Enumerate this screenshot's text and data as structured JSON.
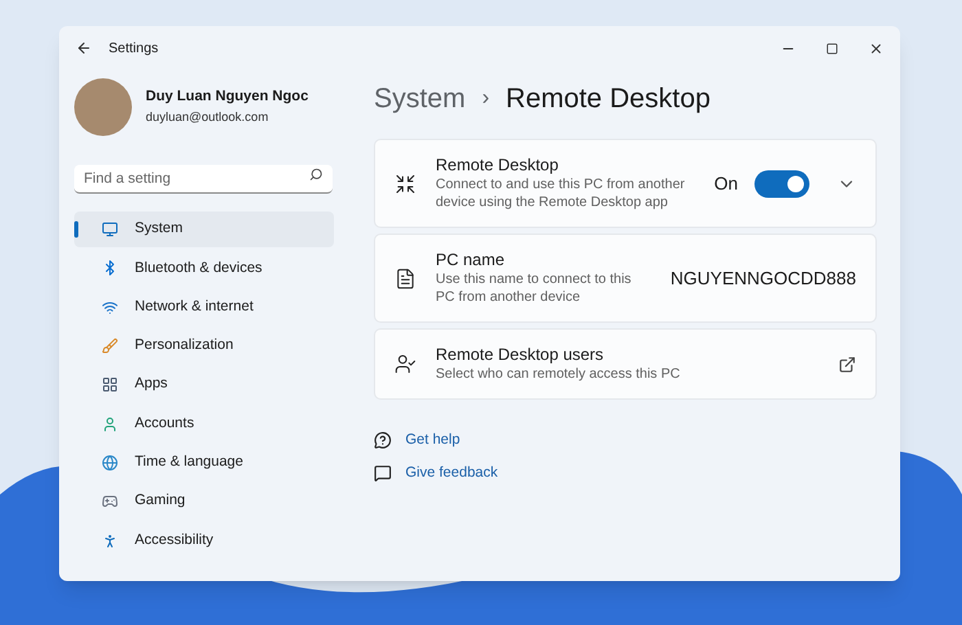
{
  "window": {
    "title": "Settings"
  },
  "account": {
    "name": "Duy Luan Nguyen Ngoc",
    "email": "duyluan@outlook.com"
  },
  "search": {
    "placeholder": "Find a setting"
  },
  "sidebar": {
    "items": [
      {
        "label": "System",
        "selected": true
      },
      {
        "label": "Bluetooth & devices",
        "selected": false
      },
      {
        "label": "Network & internet",
        "selected": false
      },
      {
        "label": "Personalization",
        "selected": false
      },
      {
        "label": "Apps",
        "selected": false
      },
      {
        "label": "Accounts",
        "selected": false
      },
      {
        "label": "Time & language",
        "selected": false
      },
      {
        "label": "Gaming",
        "selected": false
      },
      {
        "label": "Accessibility",
        "selected": false
      }
    ]
  },
  "breadcrumb": {
    "parent": "System",
    "separator": "›",
    "current": "Remote Desktop"
  },
  "cards": [
    {
      "kind": "toggle",
      "title": "Remote Desktop",
      "description": "Connect to and use this PC from another device using the Remote Desktop app",
      "state_label": "On",
      "on": true,
      "expanded": false
    },
    {
      "kind": "value",
      "title": "PC name",
      "description": "Use this name to connect to this PC from another device",
      "value": "NGUYENNGOCDD888"
    },
    {
      "kind": "link",
      "title": "Remote Desktop users",
      "description": "Select who can remotely access this PC"
    }
  ],
  "help_links": [
    "Get help",
    "Give feedback"
  ]
}
